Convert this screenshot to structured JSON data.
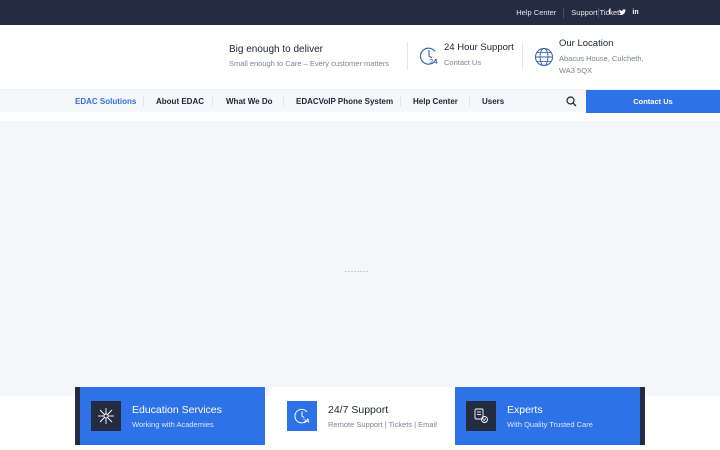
{
  "topbar": {
    "links": [
      "Help Center",
      "Support Tickets"
    ],
    "social": [
      {
        "icon": "facebook-icon",
        "glyph": "f"
      },
      {
        "icon": "twitter-icon",
        "glyph": "t"
      },
      {
        "icon": "linkedin-icon",
        "glyph": "in"
      }
    ]
  },
  "header": {
    "tagline_title": "Big enough to deliver",
    "tagline_sub": "Small enough to Care – Every customer matters",
    "support": {
      "title": "24 Hour Support",
      "sub": "Contact Us",
      "icon": "clock-24-icon"
    },
    "location": {
      "title": "Our Location",
      "line1": "Abacus House, Culcheth,",
      "line2": "WA3 5QX",
      "icon": "globe-icon"
    }
  },
  "nav": {
    "items": [
      "EDAC Solutions",
      "About EDAC",
      "What We Do",
      "EDACVoIP Phone System",
      "Help Center",
      "Users"
    ],
    "active_index": 0,
    "search_icon": "search-icon",
    "contact_label": "Contact Us"
  },
  "cards": [
    {
      "title": "Education Services",
      "sub": "Working with Academies",
      "icon": "network-icon",
      "style": "blue"
    },
    {
      "title": "24/7 Support",
      "sub": "Remote Support | Tickets | Email",
      "icon": "clock-24-icon",
      "style": "white"
    },
    {
      "title": "Experts",
      "sub": "With Quality Trusted Care",
      "icon": "expert-icon",
      "style": "blue"
    }
  ],
  "colors": {
    "topbar": "#232c41",
    "accent": "#2e72e8",
    "nav_bg": "#f6f7fb",
    "hero_bg": "#f5f6f9"
  }
}
